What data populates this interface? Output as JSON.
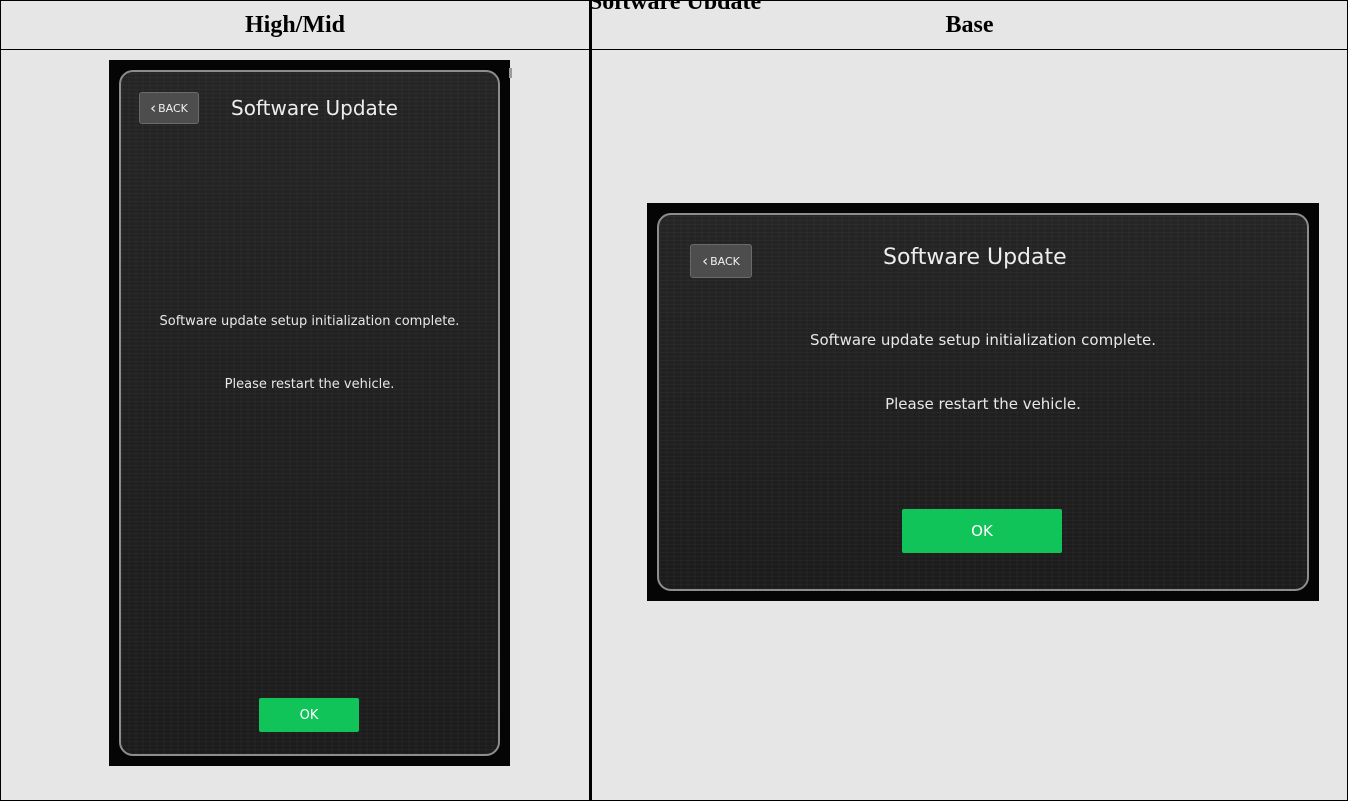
{
  "document": {
    "top_partial_text": "Software Update"
  },
  "columns": [
    {
      "header": "High/Mid",
      "screen": {
        "back_label": "BACK",
        "title": "Software Update",
        "message_line_1": "Software update setup initialization complete.",
        "message_line_2": "Please restart the vehicle.",
        "ok_label": "OK"
      }
    },
    {
      "header": "Base",
      "screen": {
        "back_label": "BACK",
        "title": "Software Update",
        "message_line_1": "Software update setup initialization complete.",
        "message_line_2": "Please restart the vehicle.",
        "ok_label": "OK"
      }
    }
  ],
  "colors": {
    "ok_button": "#10c459",
    "cell_background": "#e6e6e6",
    "screen_background": "#1f1f1f"
  },
  "icons": {
    "back": "chevron-left-icon"
  }
}
